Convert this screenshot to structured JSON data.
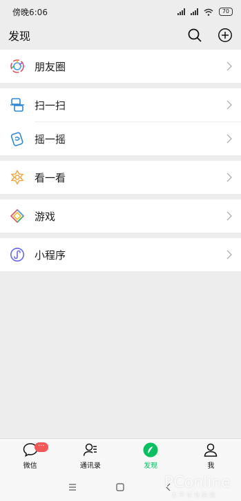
{
  "status": {
    "time": "傍晚6:06",
    "battery": "70"
  },
  "header": {
    "title": "发现",
    "search_icon": "search-icon",
    "add_icon": "add-circle-icon"
  },
  "menu": {
    "groups": [
      [
        {
          "label": "朋友圈",
          "icon": "moments-icon"
        }
      ],
      [
        {
          "label": "扫一扫",
          "icon": "scan-icon"
        },
        {
          "label": "摇一摇",
          "icon": "shake-icon"
        }
      ],
      [
        {
          "label": "看一看",
          "icon": "top-stories-icon"
        }
      ],
      [
        {
          "label": "游戏",
          "icon": "games-icon"
        }
      ],
      [
        {
          "label": "小程序",
          "icon": "mini-programs-icon"
        }
      ]
    ]
  },
  "tabbar": {
    "tabs": [
      {
        "label": "微信",
        "badge": "···"
      },
      {
        "label": "通讯录"
      },
      {
        "label": "发现",
        "active": true
      },
      {
        "label": "我"
      }
    ]
  },
  "colors": {
    "accent": "#07c160",
    "badge": "#f25855",
    "background": "#ededed"
  },
  "watermark": {
    "brand": "PConline",
    "tagline": "太平洋电脑网"
  }
}
